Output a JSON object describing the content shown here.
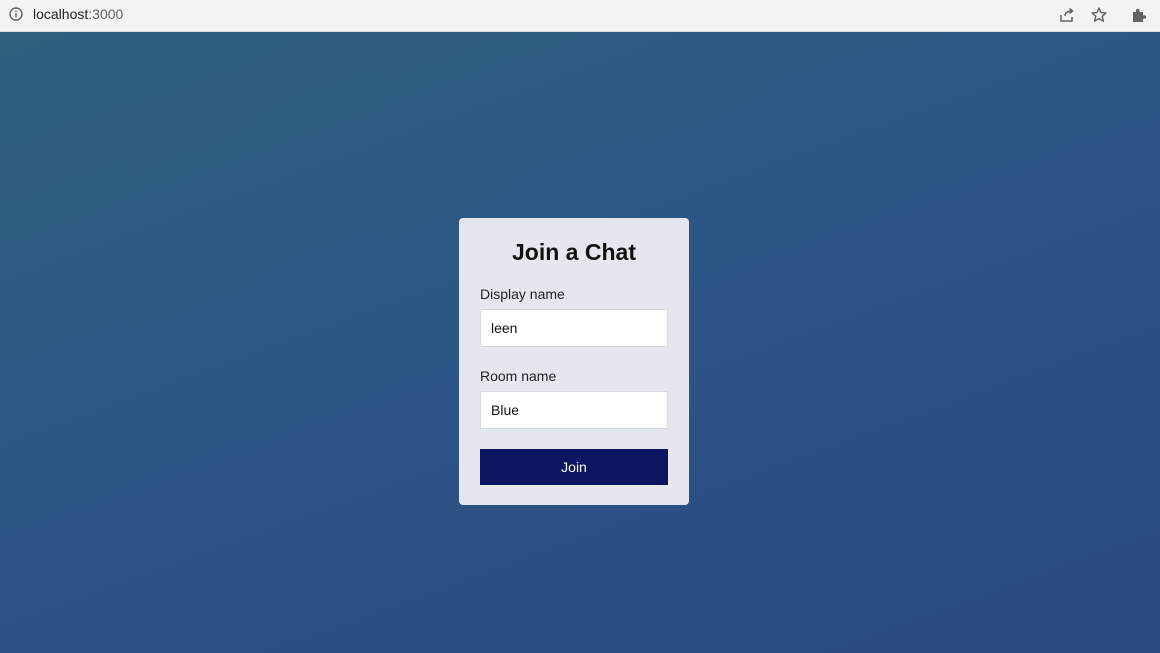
{
  "browser": {
    "url_host": "localhost",
    "url_port": ":3000",
    "icons": [
      "info-icon",
      "share-icon",
      "star-icon",
      "extensions-icon"
    ]
  },
  "form": {
    "title": "Join a Chat",
    "display_name_label": "Display name",
    "display_name_value": "leen",
    "room_name_label": "Room name",
    "room_name_value": "Blue",
    "join_label": "Join"
  },
  "colors": {
    "background_start": "#2e607f",
    "background_end": "#2a4a82",
    "card_bg": "#e4e8ee",
    "button_bg": "#0d1460",
    "button_text": "#ffffff"
  }
}
